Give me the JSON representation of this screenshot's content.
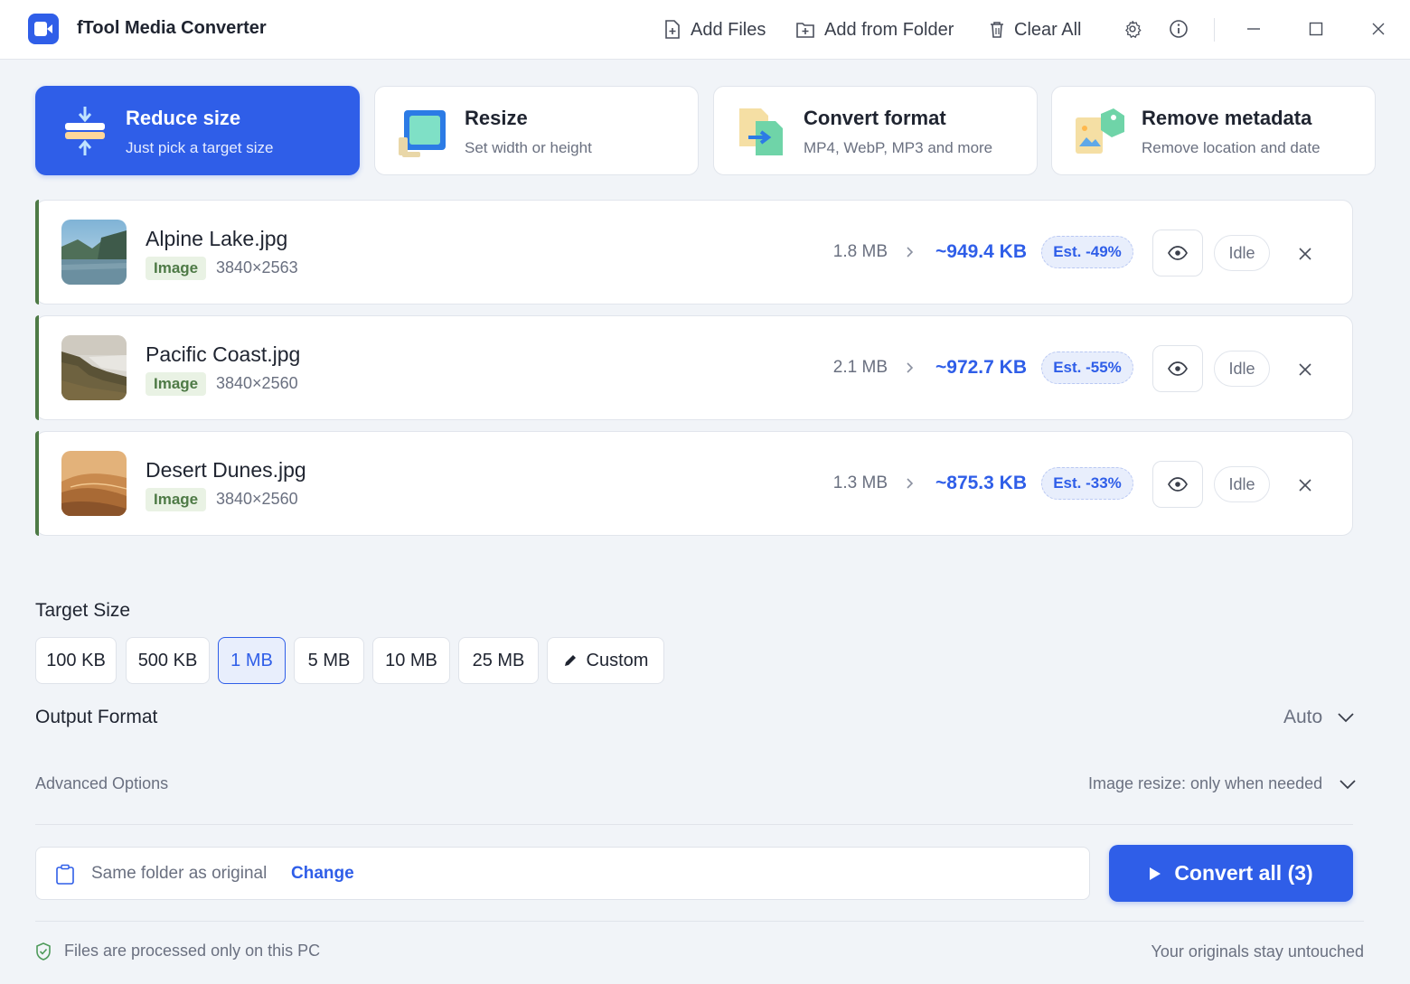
{
  "app": {
    "title": "fTool Media Converter"
  },
  "toolbar": {
    "add_files": "Add Files",
    "add_folder": "Add from Folder",
    "clear_all": "Clear All"
  },
  "modes": [
    {
      "title": "Reduce size",
      "subtitle": "Just pick a target size",
      "active": true
    },
    {
      "title": "Resize",
      "subtitle": "Set width or height",
      "active": false
    },
    {
      "title": "Convert format",
      "subtitle": "MP4, WebP, MP3 and more",
      "active": false
    },
    {
      "title": "Remove metadata",
      "subtitle": "Remove location and date",
      "active": false
    }
  ],
  "files": [
    {
      "name": "Alpine Lake.jpg",
      "type": "Image",
      "dimensions": "3840×2563",
      "original_size": "1.8 MB",
      "estimated_size": "~949.4 KB",
      "estimate_badge": "Est. -49%",
      "status": "Idle"
    },
    {
      "name": "Pacific Coast.jpg",
      "type": "Image",
      "dimensions": "3840×2560",
      "original_size": "2.1 MB",
      "estimated_size": "~972.7 KB",
      "estimate_badge": "Est. -55%",
      "status": "Idle"
    },
    {
      "name": "Desert Dunes.jpg",
      "type": "Image",
      "dimensions": "3840×2560",
      "original_size": "1.3 MB",
      "estimated_size": "~875.3 KB",
      "estimate_badge": "Est. -33%",
      "status": "Idle"
    }
  ],
  "target_size": {
    "label": "Target Size",
    "options": [
      "100 KB",
      "500 KB",
      "1 MB",
      "5 MB",
      "10 MB",
      "25 MB"
    ],
    "selected": "1 MB",
    "custom_label": "Custom"
  },
  "output_format": {
    "label": "Output Format",
    "value": "Auto"
  },
  "advanced": {
    "label": "Advanced Options",
    "value": "Image resize: only when needed"
  },
  "output_folder": {
    "text": "Same folder as original",
    "change_label": "Change"
  },
  "convert_button": "Convert all (3)",
  "footer": {
    "left": "Files are processed only on this PC",
    "right": "Your originals stay untouched"
  },
  "colors": {
    "accent": "#2f5ee8",
    "image_tag": "#4e7a46",
    "background": "#f1f4f8"
  }
}
